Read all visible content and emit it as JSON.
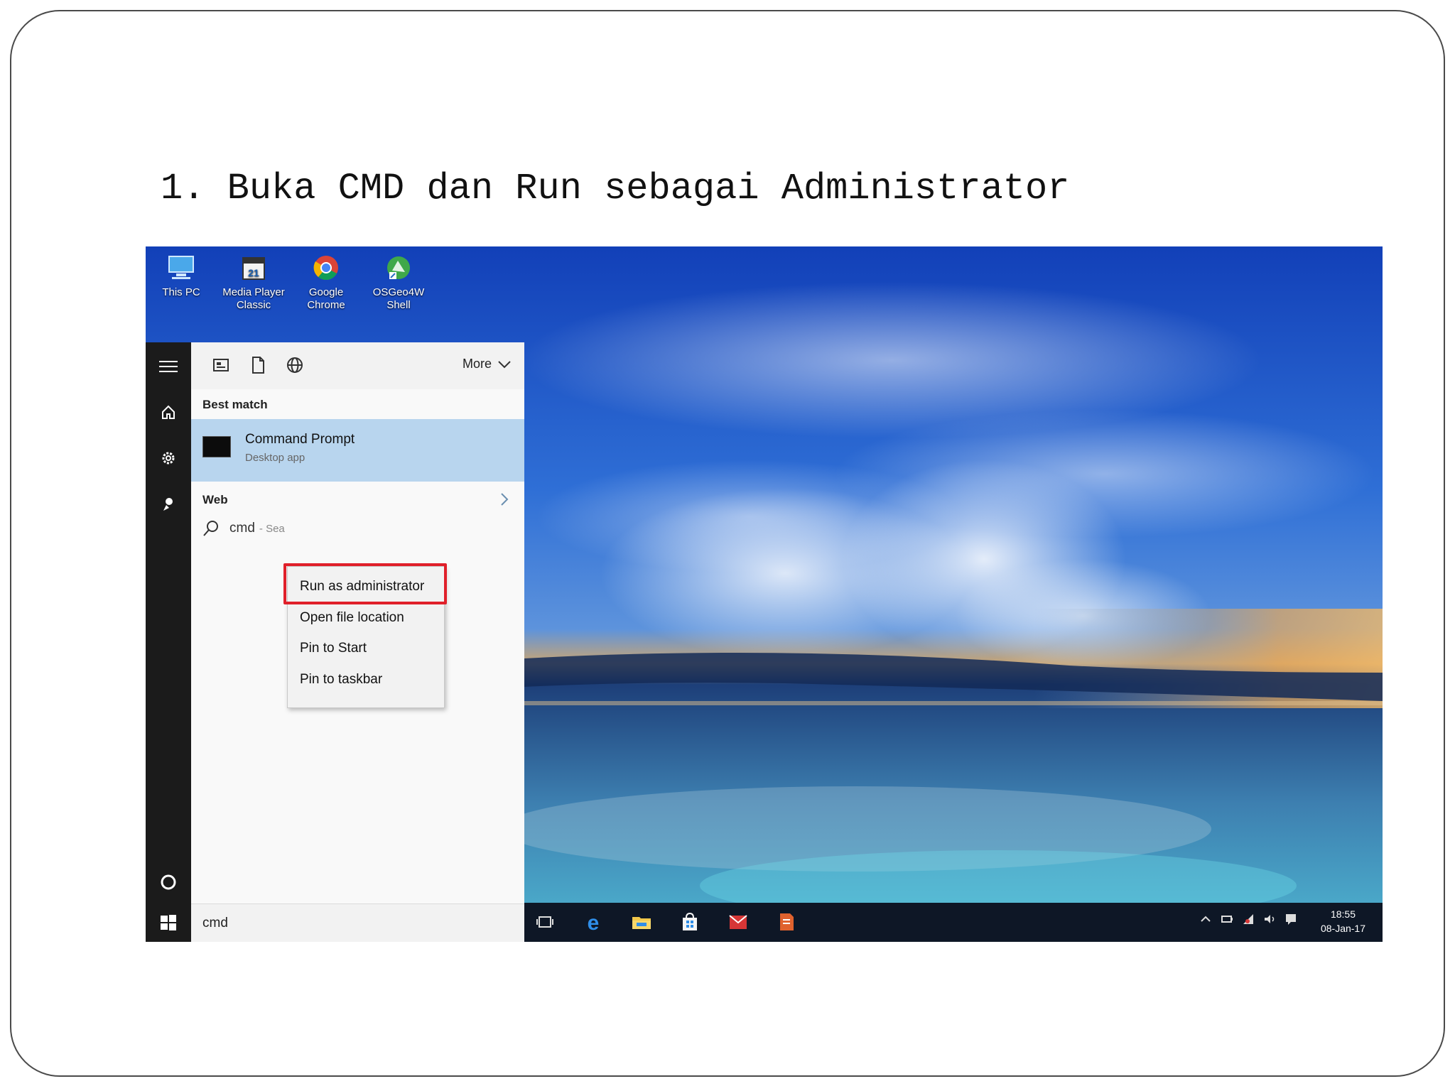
{
  "slide": {
    "title": "1. Buka CMD dan Run sebagai Administrator"
  },
  "desktop": {
    "icons": [
      {
        "name": "this-pc",
        "label": "This PC"
      },
      {
        "name": "media-player-classic",
        "label": "Media Player Classic"
      },
      {
        "name": "google-chrome",
        "label": "Google Chrome"
      },
      {
        "name": "osgeo4w-shell",
        "label": "OSGeo4W Shell"
      }
    ]
  },
  "start_menu": {
    "toolbar": {
      "more_label": "More"
    },
    "best_match_label": "Best match",
    "best_match": {
      "title": "Command Prompt",
      "subtitle": "Desktop app"
    },
    "web_label": "Web",
    "web_result": {
      "query": "cmd",
      "hint": "- Sea"
    },
    "search_value": "cmd"
  },
  "context_menu": {
    "items": [
      {
        "label": "Run as administrator"
      },
      {
        "label": "Open file location"
      },
      {
        "label": "Pin to Start"
      },
      {
        "label": "Pin to taskbar"
      }
    ],
    "highlight_color": "#e0202a"
  },
  "taskbar": {
    "time": "18:55",
    "date": "08-Jan-17"
  },
  "colors": {
    "start_rail": "#1b1b1b",
    "selection": "#b8d5ee",
    "taskbar": "#0e1726"
  }
}
